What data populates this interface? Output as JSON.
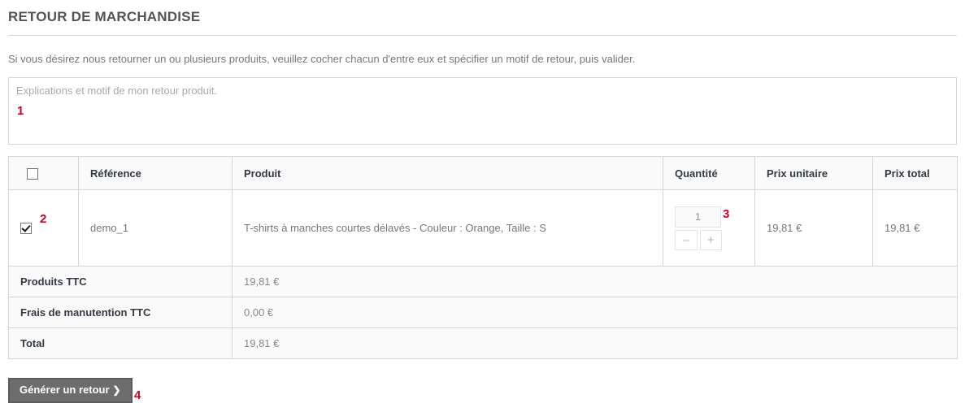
{
  "page": {
    "title": "RETOUR DE MARCHANDISE",
    "intro": "Si vous désirez nous retourner un ou plusieurs produits, veuillez cocher chacun d'entre eux et spécifier un motif de retour, puis valider."
  },
  "textarea": {
    "placeholder": "Explications et motif de mon retour produit.",
    "value": ""
  },
  "annotations": {
    "one": "1",
    "two": "2",
    "three": "3",
    "four": "4",
    "color": "#cc0022"
  },
  "table": {
    "headers": {
      "select_all": "",
      "reference": "Référence",
      "product": "Produit",
      "quantity": "Quantité",
      "unit_price": "Prix unitaire",
      "total_price": "Prix total"
    },
    "rows": [
      {
        "checked": true,
        "reference": "demo_1",
        "product": "T-shirts à manches courtes délavés - Couleur : Orange, Taille : S",
        "quantity": "1",
        "minus_label": "–",
        "plus_label": "+",
        "unit_price": "19,81 €",
        "total_price": "19,81 €"
      }
    ],
    "summary": [
      {
        "label": "Produits TTC",
        "value": "19,81 €"
      },
      {
        "label": "Frais de manutention TTC",
        "value": "0,00 €"
      },
      {
        "label": "Total",
        "value": "19,81 €"
      }
    ]
  },
  "submit": {
    "label": "Générer un retour",
    "chevron": "❯"
  },
  "colors": {
    "title": "#555454",
    "text": "#777777",
    "header_text": "#333a44",
    "border": "#d6d4d4",
    "header_bg": "#fafafa",
    "button_bg": "#6d6d6d",
    "button_border": "#5c5c5c"
  }
}
